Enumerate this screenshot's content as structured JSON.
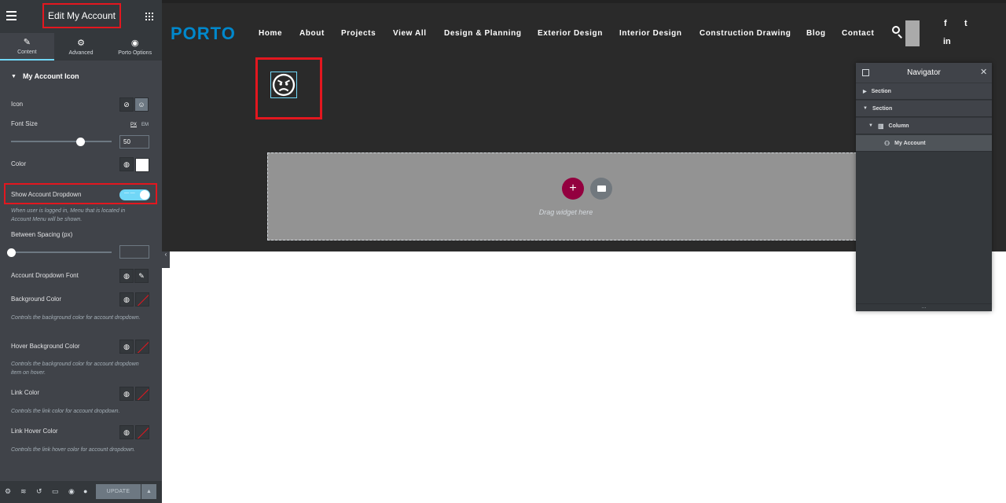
{
  "panel": {
    "title": "Edit My Account",
    "tabs": [
      {
        "label": "Content",
        "icon": "pencil-icon"
      },
      {
        "label": "Advanced",
        "icon": "gear-icon"
      },
      {
        "label": "Porto Options",
        "icon": "circle-dot-icon"
      }
    ],
    "section_title": "My Account Icon",
    "controls": {
      "icon_label": "Icon",
      "font_size_label": "Font Size",
      "font_size_value": "50",
      "font_size_fraction": 0.69,
      "unit_px": "PX",
      "unit_em": "EM",
      "color_label": "Color",
      "color_value": "#ffffff",
      "show_dropdown_label": "Show Account Dropdown",
      "show_dropdown_on": true,
      "show_dropdown_desc": "When user is logged in, Menu that is located in Account Menu will be shown.",
      "spacing_label": "Between Spacing (px)",
      "spacing_value": "",
      "dropdown_font_label": "Account Dropdown Font",
      "bg_color_label": "Background Color",
      "bg_color_desc": "Controls the background color for account dropdown.",
      "hover_bg_label": "Hover Background Color",
      "hover_bg_desc": "Controls the background color for account dropdown item on hover.",
      "link_color_label": "Link Color",
      "link_color_desc": "Controls the link color for account dropdown.",
      "link_hover_label": "Link Hover Color",
      "link_hover_desc": "Controls the link hover color for account dropdown."
    },
    "footer": {
      "update_label": "UPDATE"
    }
  },
  "site": {
    "logo": "PORTO",
    "nav": [
      "Home",
      "About",
      "Projects",
      "View All",
      "Design & Planning",
      "Exterior Design",
      "Interior Design",
      "Construction Drawing",
      "Blog",
      "Contact"
    ],
    "drop_hint": "Drag widget here",
    "social": [
      "f",
      "t",
      "in"
    ]
  },
  "navigator": {
    "title": "Navigator",
    "rows": [
      {
        "label": "Section",
        "depth": 0,
        "expanded": false
      },
      {
        "label": "Section",
        "depth": 0,
        "expanded": true
      },
      {
        "label": "Column",
        "depth": 1,
        "expanded": true
      },
      {
        "label": "My Account",
        "depth": 2,
        "expanded": false
      }
    ],
    "foot": "..."
  },
  "colors": {
    "accent_red": "#e3171f",
    "toggle_on": "#71d7f7",
    "add_button": "#93003f",
    "logo_blue": "#0088cc"
  }
}
